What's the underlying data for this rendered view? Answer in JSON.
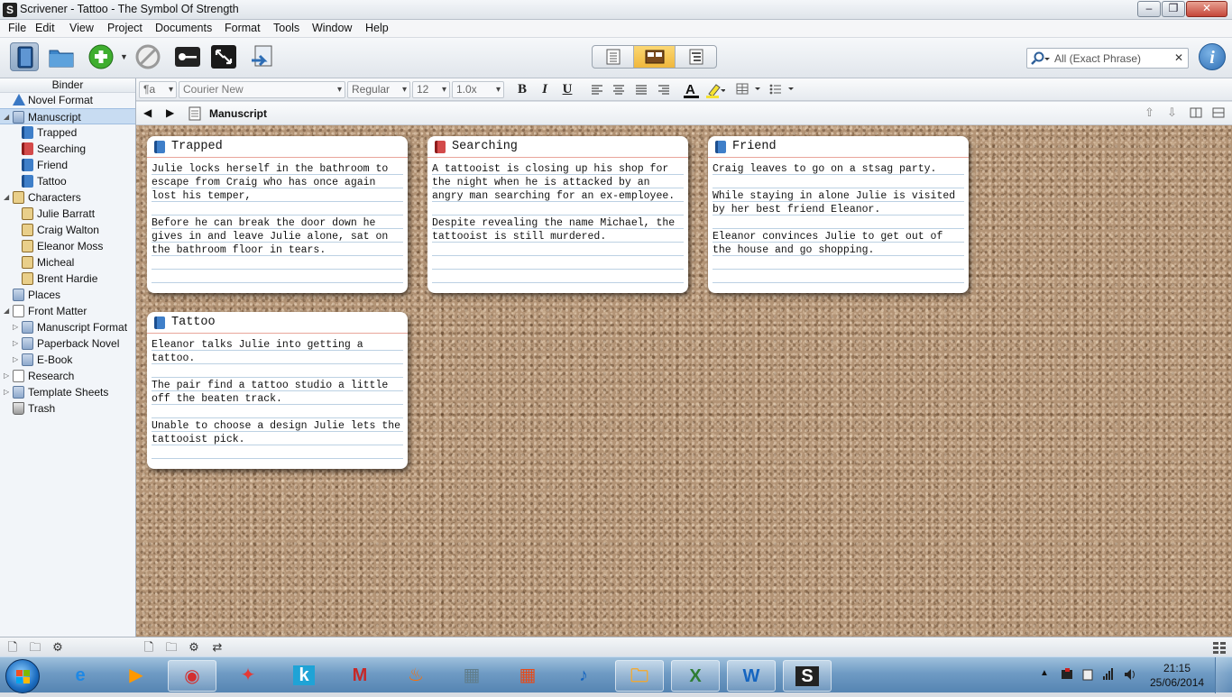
{
  "window": {
    "title": "Scrivener - Tattoo - The Symbol Of Strength"
  },
  "menu": [
    "File",
    "Edit",
    "View",
    "Project",
    "Documents",
    "Format",
    "Tools",
    "Window",
    "Help"
  ],
  "toolbar": {
    "icons": [
      "binder-toggle-icon",
      "project-folder-icon",
      "add-icon",
      "delete-icon",
      "keywords-icon",
      "full-screen-icon",
      "compile-icon"
    ],
    "view_modes": [
      "scrivenings-icon",
      "corkboard-icon",
      "outline-icon"
    ],
    "active_view": 1,
    "search_value": "All (Exact Phrase)",
    "search_clear": "✕",
    "info_label": "i"
  },
  "binder": {
    "header": "Binder",
    "items": [
      {
        "label": "Novel Format",
        "icon": "warn",
        "indent": 0,
        "tri": ""
      },
      {
        "label": "Manuscript",
        "icon": "folder",
        "indent": 0,
        "tri": "◢",
        "selected": true
      },
      {
        "label": "Trapped",
        "icon": "blue",
        "indent": 1,
        "tri": ""
      },
      {
        "label": "Searching",
        "icon": "red",
        "indent": 1,
        "tri": ""
      },
      {
        "label": "Friend",
        "icon": "blue",
        "indent": 1,
        "tri": ""
      },
      {
        "label": "Tattoo",
        "icon": "blue",
        "indent": 1,
        "tri": ""
      },
      {
        "label": "Characters",
        "icon": "char",
        "indent": 0,
        "tri": "◢"
      },
      {
        "label": "Julie Barratt",
        "icon": "char",
        "indent": 1,
        "tri": ""
      },
      {
        "label": "Craig Walton",
        "icon": "char",
        "indent": 1,
        "tri": ""
      },
      {
        "label": "Eleanor Moss",
        "icon": "char",
        "indent": 1,
        "tri": ""
      },
      {
        "label": "Micheal",
        "icon": "char",
        "indent": 1,
        "tri": ""
      },
      {
        "label": "Brent Hardie",
        "icon": "char",
        "indent": 1,
        "tri": ""
      },
      {
        "label": "Places",
        "icon": "folder",
        "indent": 0,
        "tri": ""
      },
      {
        "label": "Front Matter",
        "icon": "page",
        "indent": 0,
        "tri": "◢"
      },
      {
        "label": "Manuscript Format",
        "icon": "folder",
        "indent": 1,
        "tri": "▷"
      },
      {
        "label": "Paperback Novel",
        "icon": "folder",
        "indent": 1,
        "tri": "▷"
      },
      {
        "label": "E-Book",
        "icon": "folder",
        "indent": 1,
        "tri": "▷"
      },
      {
        "label": "Research",
        "icon": "page",
        "indent": 0,
        "tri": "▷"
      },
      {
        "label": "Template Sheets",
        "icon": "folder",
        "indent": 0,
        "tri": "▷"
      },
      {
        "label": "Trash",
        "icon": "trash",
        "indent": 0,
        "tri": ""
      }
    ]
  },
  "format": {
    "style": "¶a",
    "font": "Courier New",
    "weight": "Regular",
    "size": "12",
    "spacing": "1.0x",
    "bold": "B",
    "italic": "I",
    "underline": "U"
  },
  "header": {
    "title": "Manuscript",
    "back": "◀",
    "forward": "▶"
  },
  "cards": [
    {
      "title": "Trapped",
      "color": "blue",
      "body": "Julie locks herself in the bathroom to escape from Craig who has once again lost his temper,\n\nBefore he can break the door down he gives in and leave Julie alone, sat on the bathroom floor in tears."
    },
    {
      "title": "Searching",
      "color": "red",
      "body": "A tattooist is closing up his shop for the night when he is attacked by an angry man searching for an ex-employee.\n\nDespite revealing the name Michael, the tattooist is still murdered."
    },
    {
      "title": "Friend",
      "color": "blue",
      "body": "Craig leaves to go on a stsag party.\n\nWhile staying in alone Julie is visited by her best friend Eleanor.\n\nEleanor convinces Julie to get out of the house and go shopping."
    },
    {
      "title": "Tattoo",
      "color": "blue",
      "body": "Eleanor talks Julie into getting a tattoo.\n\nThe pair find a tattoo studio a little off the beaten track.\n\nUnable to choose a design Julie lets the tattooist pick."
    }
  ],
  "taskbar": {
    "apps": [
      "internet-explorer-icon",
      "media-center-icon",
      "chrome-icon",
      "app-icon",
      "kindle-icon",
      "mcafee-icon",
      "firefox-like-icon",
      "calculator-icon",
      "apps-grid-icon",
      "itunes-icon",
      "explorer-icon",
      "excel-icon",
      "word-icon",
      "scrivener-icon"
    ],
    "time": "21:15",
    "date": "25/06/2014"
  }
}
